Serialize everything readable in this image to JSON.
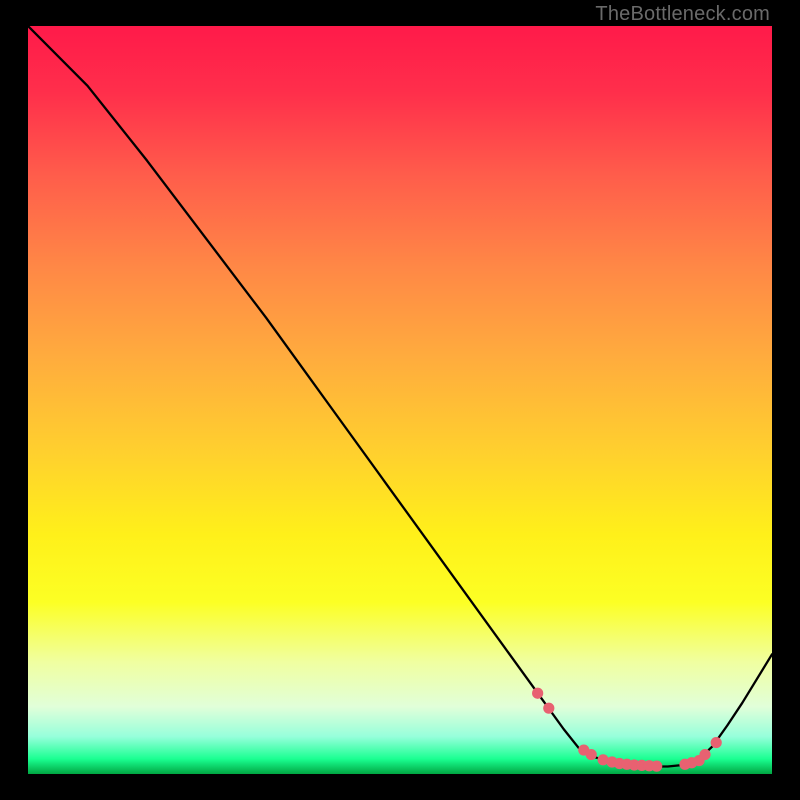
{
  "attribution": "TheBottleneck.com",
  "colors": {
    "curve_stroke": "#000000",
    "point_fill": "#e86171",
    "point_stroke": "#e86171"
  },
  "chart_data": {
    "type": "line",
    "title": "",
    "xlabel": "",
    "ylabel": "",
    "xlim": [
      0,
      100
    ],
    "ylim": [
      0,
      100
    ],
    "grid": false,
    "legend": null,
    "series": [
      {
        "name": "bottleneck_curve",
        "x": [
          0,
          8,
          16,
          24,
          32,
          40,
          48,
          56,
          64,
          68,
          72,
          74,
          76,
          78,
          80,
          84,
          86,
          88,
          89,
          90,
          92,
          94,
          96,
          100
        ],
        "y": [
          100,
          92,
          82,
          71.5,
          61,
          50,
          39,
          28,
          17,
          11.5,
          6,
          3.5,
          2.3,
          1.7,
          1.3,
          1,
          1,
          1.2,
          1.4,
          1.8,
          3.7,
          6.5,
          9.5,
          16
        ]
      }
    ],
    "highlight_points": {
      "x": [
        68.5,
        70,
        74.7,
        75.7,
        77.3,
        78.5,
        79.5,
        80.5,
        81.5,
        82.5,
        83.5,
        84.5,
        88.3,
        89.2,
        90.2,
        91,
        92.5
      ],
      "y": [
        10.8,
        8.8,
        3.2,
        2.6,
        1.9,
        1.6,
        1.4,
        1.3,
        1.2,
        1.15,
        1.1,
        1.05,
        1.3,
        1.5,
        1.8,
        2.6,
        4.2
      ]
    }
  }
}
